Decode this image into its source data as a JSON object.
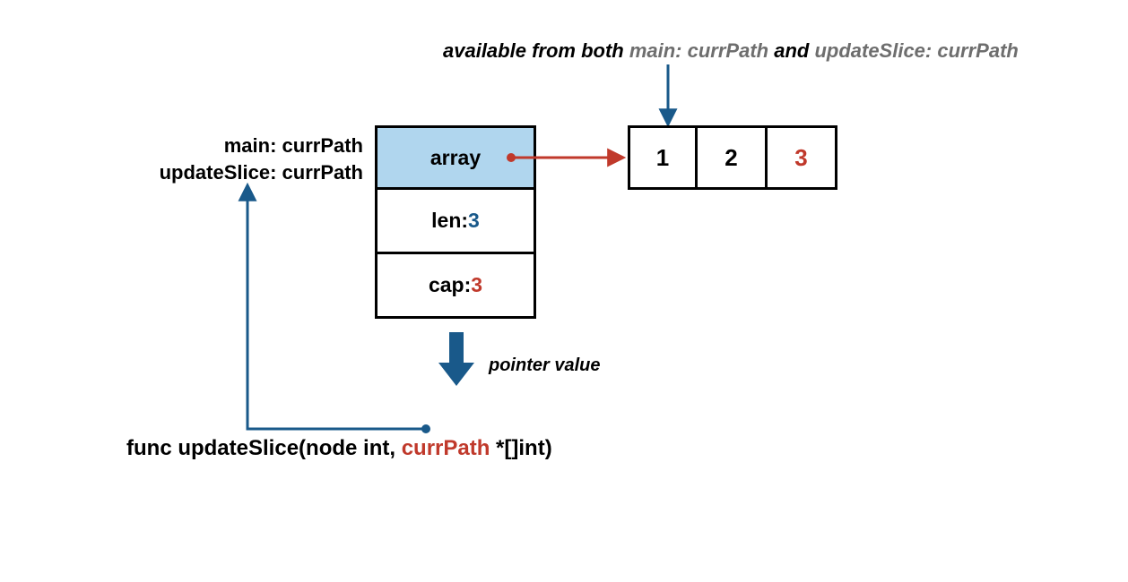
{
  "annotation": {
    "lead": "available from both ",
    "part1": "main: currPath",
    "mid": " and ",
    "part2": "updateSlice: currPath"
  },
  "labels": {
    "line1": "main: currPath",
    "line2": "updateSlice: currPath"
  },
  "sliceHeader": {
    "array_label": "array",
    "len_label": "len: ",
    "len_value": "3",
    "cap_label": "cap: ",
    "cap_value": "3"
  },
  "backingArray": {
    "v0": "1",
    "v1": "2",
    "v2": "3"
  },
  "pointerValueLabel": "pointer value",
  "fn": {
    "pre": "func updateSlice(node int, ",
    "param": "currPath",
    "post": " *[]int)"
  },
  "colors": {
    "teal": "#19598a",
    "red": "#c0392b",
    "arrayFill": "#b0d6ee",
    "grey": "#6e6e6e"
  }
}
